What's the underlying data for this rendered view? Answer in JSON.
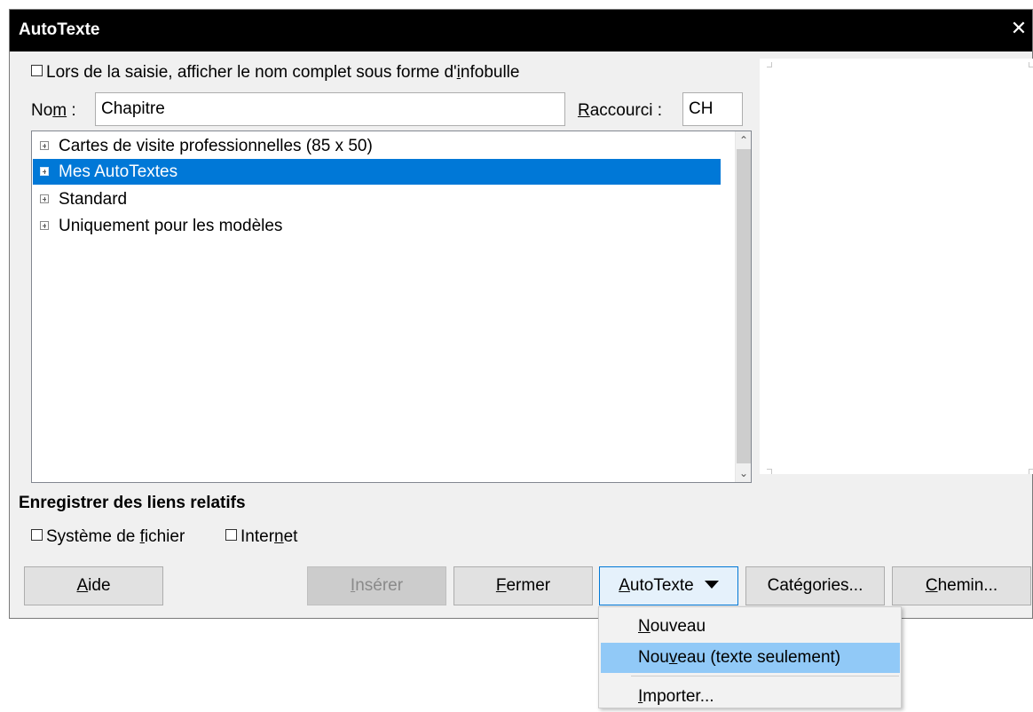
{
  "window": {
    "title": "AutoTexte",
    "close_glyph": "✕"
  },
  "tooltip_option": {
    "label_pre": "Lors de la saisie, afficher le nom complet sous forme d'",
    "label_accel": "i",
    "label_post": "nfobulle",
    "checked": false
  },
  "name_field": {
    "label_pre": "No",
    "label_accel": "m",
    "label_post": " :",
    "value": "Chapitre"
  },
  "shortcut_field": {
    "label_accel": "R",
    "label_post": "accourci :",
    "value": "CH"
  },
  "tree": {
    "items": [
      {
        "label": "Cartes de visite professionnelles (85 x 50)",
        "selected": false
      },
      {
        "label": "Mes AutoTextes",
        "selected": true
      },
      {
        "label": "Standard",
        "selected": false
      },
      {
        "label": "Uniquement pour les modèles",
        "selected": false
      }
    ]
  },
  "relative_links": {
    "title": "Enregistrer des liens relatifs",
    "filesystem": {
      "label_pre": "Système de ",
      "label_accel": "f",
      "label_post": "ichier",
      "checked": false
    },
    "internet": {
      "label_pre": "Inter",
      "label_accel": "n",
      "label_post": "et",
      "checked": false
    }
  },
  "buttons": {
    "help": {
      "accel": "A",
      "rest": "ide"
    },
    "insert": {
      "accel": "I",
      "rest": "nsérer",
      "disabled": true
    },
    "close": {
      "accel": "F",
      "rest": "ermer"
    },
    "autotext": {
      "accel": "A",
      "rest": "utoTexte"
    },
    "categories": {
      "pre": "Caté",
      "accel": "g",
      "rest": "ories..."
    },
    "path": {
      "accel": "C",
      "rest": "hemin..."
    }
  },
  "menu": {
    "items": [
      {
        "pre": "",
        "accel": "N",
        "post": "ouveau"
      },
      {
        "pre": "Nou",
        "accel": "v",
        "post": "eau (texte seulement)"
      },
      {
        "pre": "",
        "accel": "I",
        "post": "mporter..."
      }
    ],
    "hovered_index": 1
  }
}
